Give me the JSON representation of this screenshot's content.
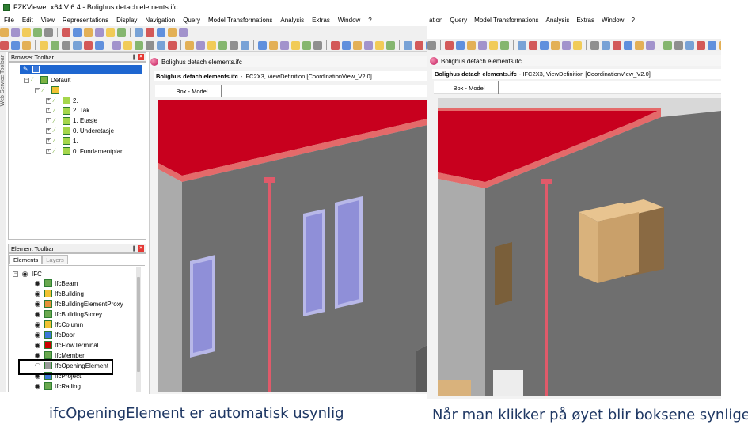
{
  "window": {
    "title": "FZKViewer x64 V 6.4 - Bolighus detach elements.ifc"
  },
  "menu_left": [
    "File",
    "Edit",
    "View",
    "Representations",
    "Display",
    "Navigation",
    "Query",
    "Model Transformations",
    "Analysis",
    "Extras",
    "Window",
    "?"
  ],
  "menu_right": [
    "ation",
    "Query",
    "Model Transformations",
    "Analysis",
    "Extras",
    "Window",
    "?"
  ],
  "side_tab": {
    "label": "Web Service Toolbar"
  },
  "browser_toolbar": {
    "title": "Browser Toolbar",
    "pin": "❙",
    "close": "×",
    "root": "Default",
    "storeys": [
      "2.",
      "2. Tak",
      "1. Etasje",
      "0. Underetasje",
      "1.",
      "0. Fundamentplan"
    ]
  },
  "element_toolbar": {
    "title": "Element Toolbar",
    "pin": "❙",
    "close": "×",
    "tabs": [
      "Elements",
      "Layers"
    ],
    "root": "IFC",
    "items": [
      {
        "label": "IfcBeam",
        "color": "#6aa84f"
      },
      {
        "label": "IfcBuilding",
        "color": "#f1c232"
      },
      {
        "label": "IfcBuildingElementProxy",
        "color": "#e69138"
      },
      {
        "label": "IfcBuildingStorey",
        "color": "#6aa84f"
      },
      {
        "label": "IfcColumn",
        "color": "#f1c232"
      },
      {
        "label": "IfcDoor",
        "color": "#3c78d8"
      },
      {
        "label": "IfcFlowTerminal",
        "color": "#cc0000"
      },
      {
        "label": "IfcMember",
        "color": "#6aa84f"
      },
      {
        "label": "IfcOpeningElement",
        "color": "#999999",
        "hidden": true
      },
      {
        "label": "IfcProject",
        "color": "#3c78d8"
      },
      {
        "label": "IfcRailing",
        "color": "#6aa84f"
      }
    ]
  },
  "left_view": {
    "doc_title": "Bolighus detach elements.ifc",
    "info_file": "Bolighus detach elements.ifc",
    "info_rest": "- IFC2X3, ViewDefinition [CoordinationView_V2.0]",
    "tab": "Box - Model"
  },
  "right_view": {
    "doc_title": "Bolighus detach elements.ifc",
    "info_file": "Bolighus detach elements.ifc",
    "info_rest": "- IFC2X3, ViewDefinition [CoordinationView_V2.0]",
    "tab": "Box - Model"
  },
  "captions": {
    "left": "ifcOpeningElement er automatisk usynlig",
    "right": "Når man klikker på øyet blir boksene synlige"
  },
  "icons": {
    "visible": "eye-open-icon",
    "hidden": "eye-closed-icon"
  },
  "colors": {
    "wall": "#6f6f6f",
    "roof": "#c8001e",
    "drainpipe": "#e05a6a",
    "window_glass": "#8f8fd8",
    "opening_box": "#d9b27c",
    "highlight": "#000000"
  }
}
